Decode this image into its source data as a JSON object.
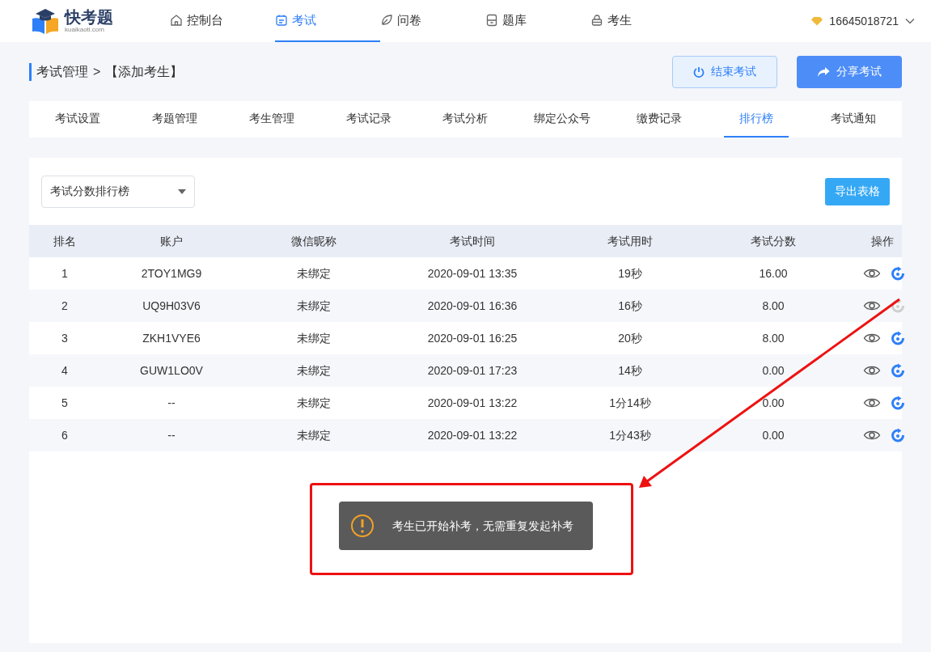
{
  "logo": {
    "name": "快考题",
    "domain": "kuaikaoti.com"
  },
  "nav": [
    {
      "label": "控制台",
      "kind": "home",
      "selected": false
    },
    {
      "label": "考试",
      "kind": "calendar",
      "selected": true
    },
    {
      "label": "问卷",
      "kind": "leaf",
      "selected": false
    },
    {
      "label": "题库",
      "kind": "archive",
      "selected": false
    },
    {
      "label": "考生",
      "kind": "lock",
      "selected": false
    }
  ],
  "user": {
    "account": "16645018721"
  },
  "breadcrumb": {
    "parent": "考试管理",
    "separator": ">",
    "current": "【添加考生】"
  },
  "actions": [
    {
      "label": "结束考试",
      "kind": "end"
    },
    {
      "label": "分享考试",
      "kind": "share"
    }
  ],
  "tabs": [
    {
      "label": "考试设置",
      "selected": false
    },
    {
      "label": "考题管理",
      "selected": false
    },
    {
      "label": "考生管理",
      "selected": false
    },
    {
      "label": "考试记录",
      "selected": false
    },
    {
      "label": "考试分析",
      "selected": false
    },
    {
      "label": "绑定公众号",
      "selected": false
    },
    {
      "label": "缴费记录",
      "selected": false
    },
    {
      "label": "排行榜",
      "selected": true
    },
    {
      "label": "考试通知",
      "selected": false
    }
  ],
  "ranking_select": {
    "value": "考试分数排行榜"
  },
  "export_button": "导出表格",
  "table": {
    "columns": [
      "排名",
      "账户",
      "微信昵称",
      "考试时间",
      "考试用时",
      "考试分数",
      "操作"
    ],
    "rows": [
      {
        "cells": [
          "1",
          "2TOY1MG9",
          "未绑定",
          "2020-09-01 13:35",
          "19秒",
          "16.00"
        ],
        "retake_disabled": false
      },
      {
        "cells": [
          "2",
          "UQ9H03V6",
          "未绑定",
          "2020-09-01 16:36",
          "16秒",
          "8.00"
        ],
        "retake_disabled": true
      },
      {
        "cells": [
          "3",
          "ZKH1VYE6",
          "未绑定",
          "2020-09-01 16:25",
          "20秒",
          "8.00"
        ],
        "retake_disabled": false
      },
      {
        "cells": [
          "4",
          "GUW1LO0V",
          "未绑定",
          "2020-09-01 17:23",
          "14秒",
          "0.00"
        ],
        "retake_disabled": false
      },
      {
        "cells": [
          "5",
          "--",
          "未绑定",
          "2020-09-01 13:22",
          "1分14秒",
          "0.00"
        ],
        "retake_disabled": false
      },
      {
        "cells": [
          "6",
          "--",
          "未绑定",
          "2020-09-01 13:22",
          "1分43秒",
          "0.00"
        ],
        "retake_disabled": false
      }
    ]
  },
  "toast": {
    "message": "考生已开始补考，无需重复发起补考",
    "kind": "warning"
  }
}
